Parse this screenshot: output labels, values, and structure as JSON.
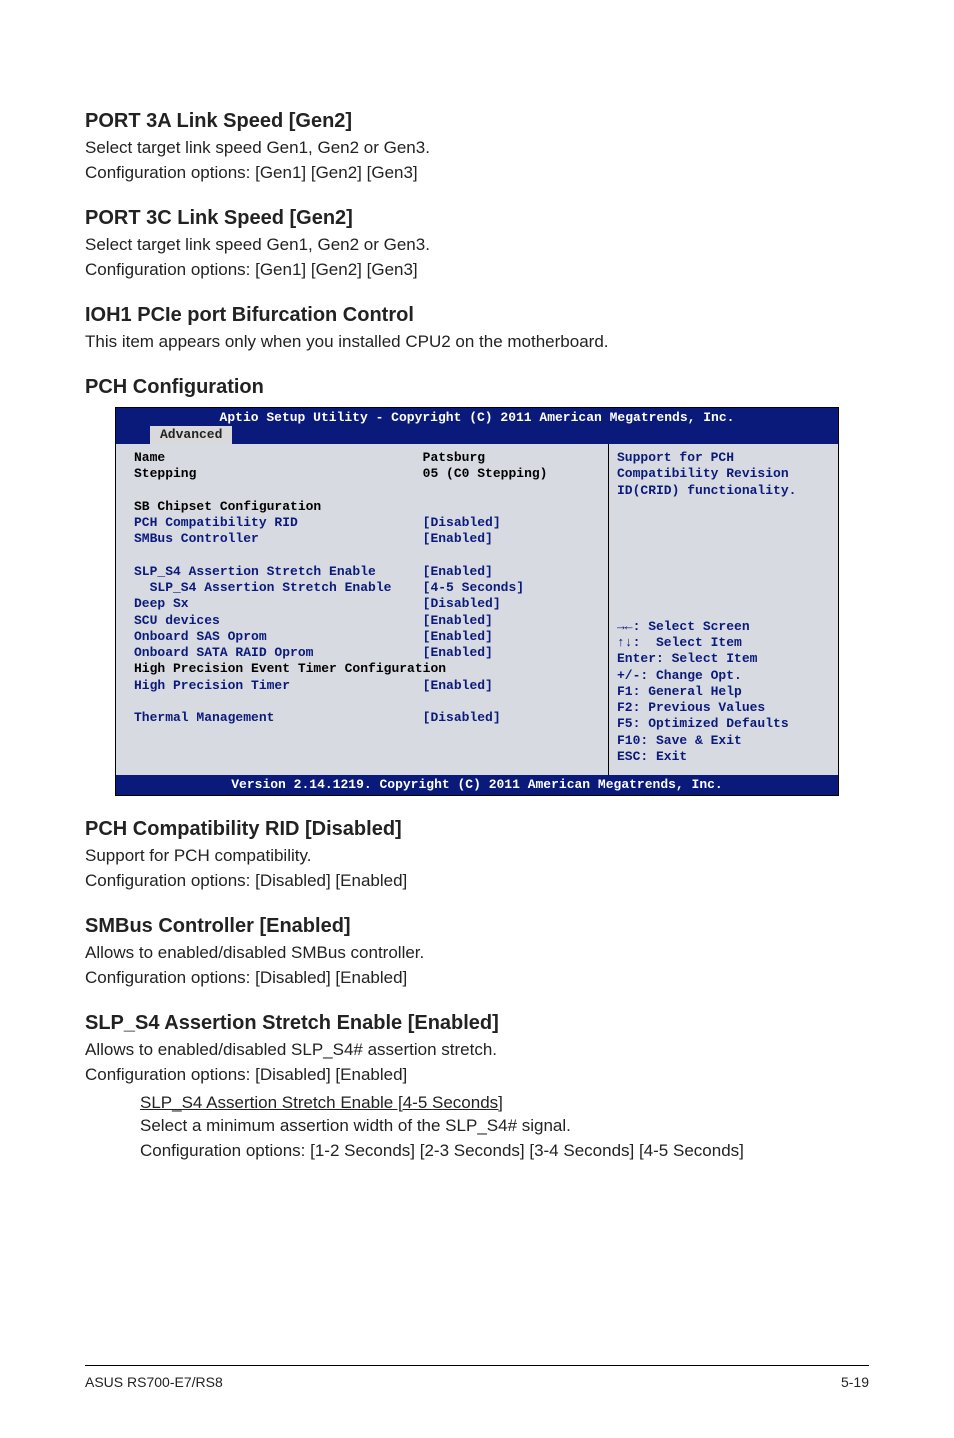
{
  "s1": {
    "title": "PORT 3A Link Speed [Gen2]",
    "line1": "Select target link speed Gen1, Gen2 or Gen3.",
    "line2": "Configuration options: [Gen1] [Gen2] [Gen3]"
  },
  "s2": {
    "title": "PORT 3C Link Speed [Gen2]",
    "line1": "Select target link speed Gen1, Gen2 or Gen3.",
    "line2": "Configuration options: [Gen1] [Gen2] [Gen3]"
  },
  "s3": {
    "title": "IOH1 PCIe port  Bifurcation Control",
    "line1": "This item appears only when you installed CPU2 on the motherboard."
  },
  "s4": {
    "title": "PCH Configuration"
  },
  "bios": {
    "header": "Aptio Setup Utility - Copyright (C) 2011 American Megatrends, Inc.",
    "tab": "Advanced",
    "left_black1": "Name                                 Patsburg\nStepping                             05 (C0 Stepping)\n\nSB Chipset Configuration",
    "left_blue1": "PCH Compatibility RID                [Disabled]\nSMBus Controller                     [Enabled]\n\nSLP_S4 Assertion Stretch Enable      [Enabled]\n  SLP_S4 Assertion Stretch Enable    [4-5 Seconds]\nDeep Sx                              [Disabled]\nSCU devices                          [Enabled]\nOnboard SAS Oprom                    [Enabled]\nOnboard SATA RAID Oprom              [Enabled]",
    "left_black2": "\nHigh Precision Event Timer Configuration",
    "left_blue2": "High Precision Timer                 [Enabled]\n\nThermal Management                   [Disabled]",
    "right_top": "Support for PCH Compatibility Revision ID(CRID) functionality.",
    "right_help": "→←: Select Screen\n↑↓:  Select Item\nEnter: Select Item\n+/-: Change Opt.\nF1: General Help\nF2: Previous Values\nF5: Optimized Defaults\nF10: Save & Exit\nESC: Exit",
    "footer": "Version 2.14.1219. Copyright (C) 2011 American Megatrends, Inc."
  },
  "s5": {
    "title": "PCH Compatibility RID [Disabled]",
    "line1": "Support for PCH compatibility.",
    "line2": "Configuration options: [Disabled] [Enabled]"
  },
  "s6": {
    "title": "SMBus Controller [Enabled]",
    "line1": "Allows to enabled/disabled SMBus controller.",
    "line2": "Configuration options: [Disabled] [Enabled]"
  },
  "s7": {
    "title": "SLP_S4 Assertion Stretch Enable [Enabled]",
    "line1": "Allows to enabled/disabled SLP_S4# assertion stretch.",
    "line2": "Configuration options: [Disabled] [Enabled]"
  },
  "sub": {
    "u": "SLP_S4 Assertion Stretch Enable [4-5 Seconds]",
    "line1": "Select a minimum assertion width of the SLP_S4# signal.",
    "line2": "Configuration options: [1-2 Seconds] [2-3 Seconds] [3-4 Seconds] [4-5 Seconds]"
  },
  "footer": {
    "left": "ASUS RS700-E7/RS8",
    "right": "5-19"
  }
}
